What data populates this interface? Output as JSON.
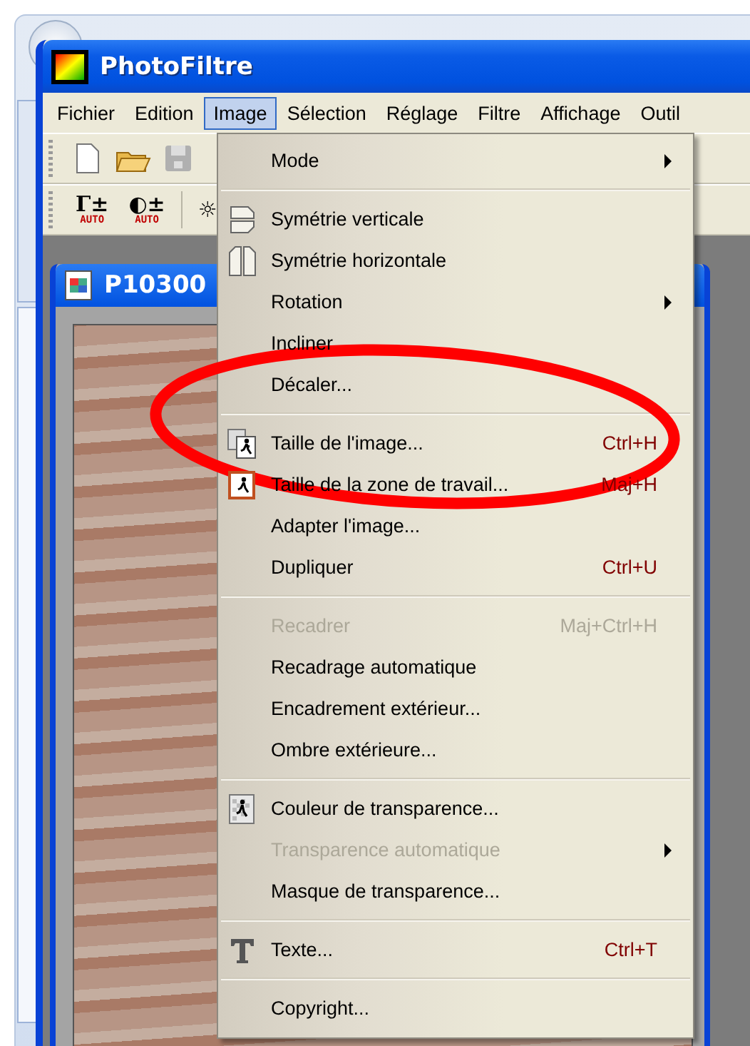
{
  "window": {
    "title": "PhotoFiltre"
  },
  "menubar": [
    {
      "label": "Fichier",
      "selected": false
    },
    {
      "label": "Edition",
      "selected": false
    },
    {
      "label": "Image",
      "selected": true
    },
    {
      "label": "Sélection",
      "selected": false
    },
    {
      "label": "Réglage",
      "selected": false
    },
    {
      "label": "Filtre",
      "selected": false
    },
    {
      "label": "Affichage",
      "selected": false
    },
    {
      "label": "Outil",
      "selected": false
    }
  ],
  "toolbar_2": [
    {
      "glyph": "Γ±",
      "badge": "AUTO"
    },
    {
      "glyph": "◐±",
      "badge": "AUTO"
    },
    {
      "glyph": "☼"
    }
  ],
  "document": {
    "title": "P10300"
  },
  "menu": [
    {
      "kind": "item",
      "label": "Mode",
      "submenu": true,
      "disabled": false
    },
    {
      "kind": "separator"
    },
    {
      "kind": "item",
      "label": "Symétrie verticale",
      "disabled": false
    },
    {
      "kind": "item",
      "label": "Symétrie horizontale",
      "disabled": false
    },
    {
      "kind": "item",
      "label": "Rotation",
      "submenu": true,
      "disabled": false
    },
    {
      "kind": "item",
      "label": "Incliner",
      "disabled": false
    },
    {
      "kind": "item",
      "label": "Décaler...",
      "disabled": false
    },
    {
      "kind": "separator"
    },
    {
      "kind": "item",
      "label": "Taille de l'image...",
      "shortcut": "Ctrl+H",
      "disabled": false
    },
    {
      "kind": "item",
      "label": "Taille de la zone de travail...",
      "shortcut": "Maj+H",
      "disabled": false
    },
    {
      "kind": "item",
      "label": "Adapter l'image...",
      "disabled": false
    },
    {
      "kind": "item",
      "label": "Dupliquer",
      "shortcut": "Ctrl+U",
      "disabled": false
    },
    {
      "kind": "separator"
    },
    {
      "kind": "item",
      "label": "Recadrer",
      "shortcut": "Maj+Ctrl+H",
      "disabled": true
    },
    {
      "kind": "item",
      "label": "Recadrage automatique",
      "disabled": false
    },
    {
      "kind": "item",
      "label": "Encadrement extérieur...",
      "disabled": false
    },
    {
      "kind": "item",
      "label": "Ombre extérieure...",
      "disabled": false
    },
    {
      "kind": "separator"
    },
    {
      "kind": "item",
      "label": "Couleur de transparence...",
      "disabled": false
    },
    {
      "kind": "item",
      "label": "Transparence automatique",
      "submenu": true,
      "disabled": true
    },
    {
      "kind": "item",
      "label": "Masque de transparence...",
      "disabled": false
    },
    {
      "kind": "separator"
    },
    {
      "kind": "item",
      "label": "Texte...",
      "shortcut": "Ctrl+T",
      "disabled": false
    },
    {
      "kind": "separator"
    },
    {
      "kind": "item",
      "label": "Copyright...",
      "disabled": false
    }
  ]
}
